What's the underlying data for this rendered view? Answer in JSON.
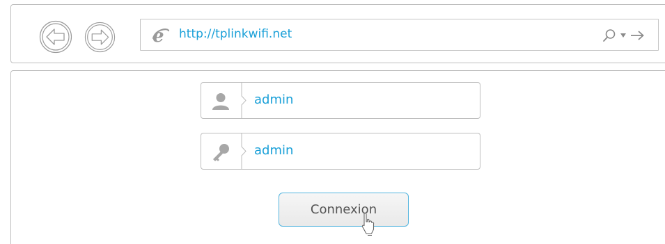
{
  "browser": {
    "address_url": "http://tplinkwifi.net",
    "icons": {
      "back": "back-arrow-icon",
      "forward": "forward-arrow-icon",
      "browser_logo": "internet-explorer-icon",
      "search": "search-icon",
      "dropdown": "dropdown-arrow-icon",
      "go": "go-arrow-icon"
    }
  },
  "login": {
    "username_value": "admin",
    "password_value": "admin",
    "submit_label": "Connexion",
    "icons": {
      "username": "user-icon",
      "password": "key-icon",
      "cursor": "mouse-pointer-icon"
    }
  },
  "colors": {
    "accent_text": "#1aa0d8",
    "button_border": "#52b4de",
    "icon_gray": "#a7a7a7",
    "border_gray": "#bdbdbd"
  }
}
